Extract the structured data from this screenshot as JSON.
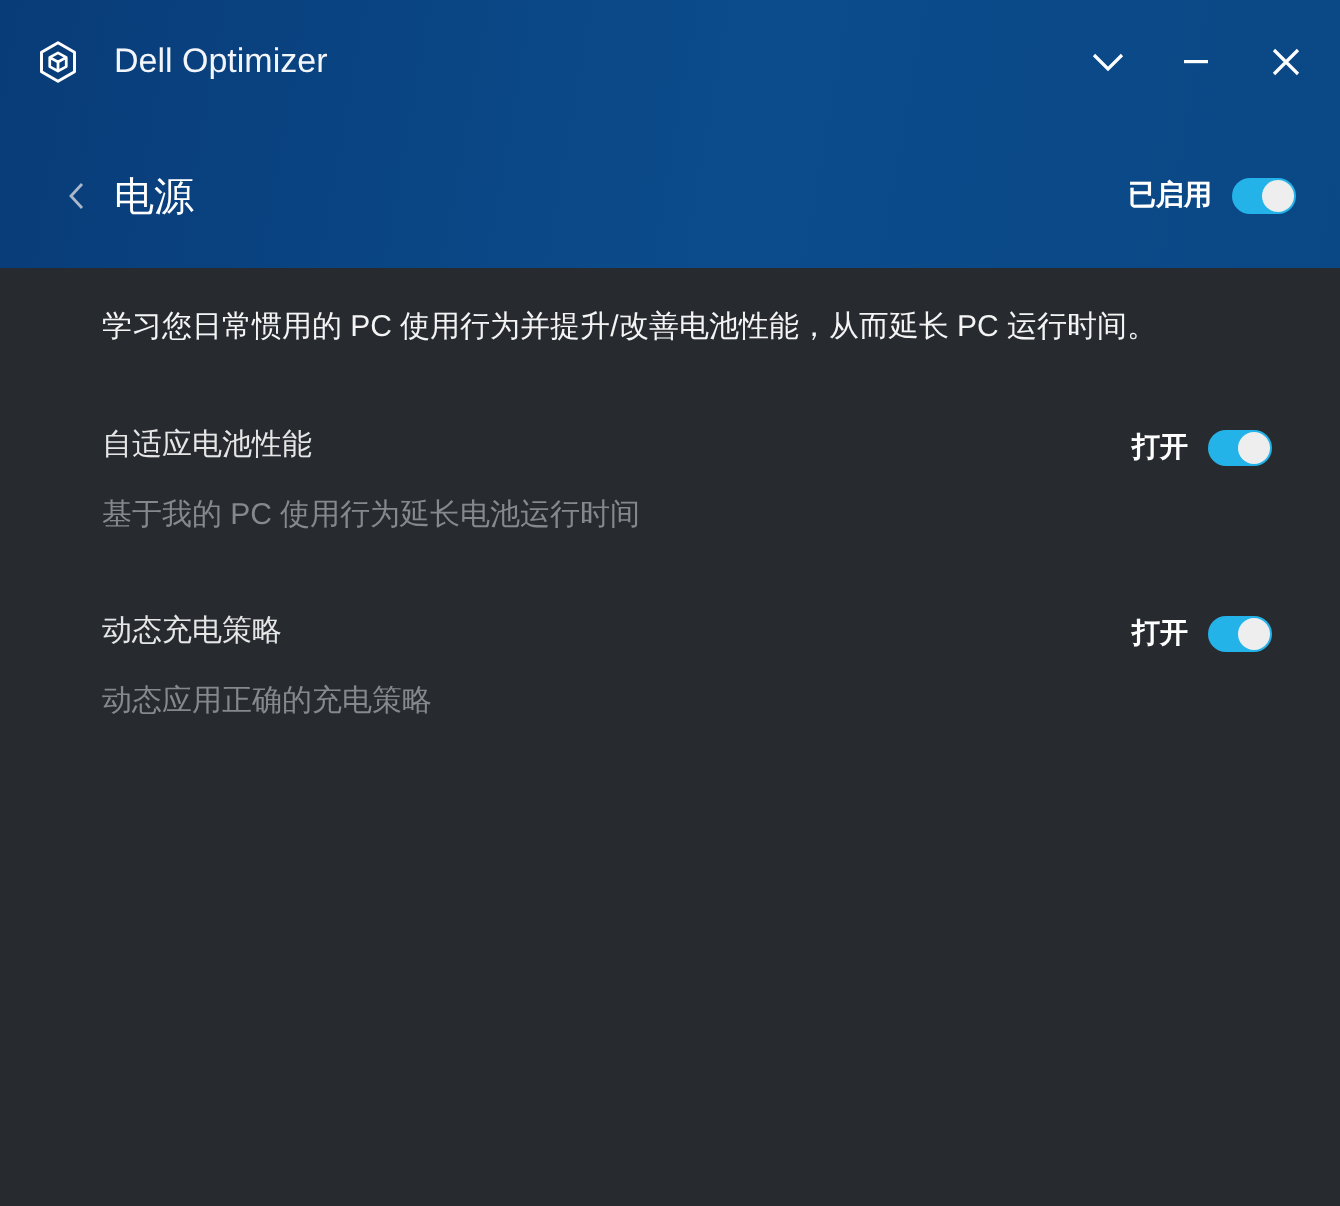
{
  "window": {
    "title": "Dell Optimizer"
  },
  "page": {
    "title": "电源",
    "status_label": "已启用",
    "enabled": true
  },
  "description": "学习您日常惯用的 PC 使用行为并提升/改善电池性能，从而延长 PC 运行时间。",
  "settings": [
    {
      "title": "自适应电池性能",
      "description": "基于我的 PC 使用行为延长电池运行时间",
      "state_label": "打开",
      "on": true
    },
    {
      "title": "动态充电策略",
      "description": "动态应用正确的充电策略",
      "state_label": "打开",
      "on": true
    }
  ]
}
